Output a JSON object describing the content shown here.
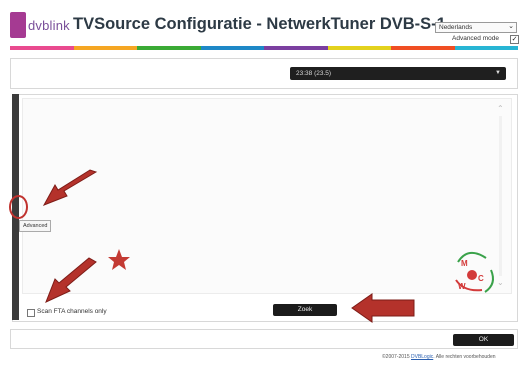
{
  "header": {
    "logo_text": "dvblink",
    "title": "TVSource Configuratie - NetwerkTuner DVB-S-1",
    "language": "Nederlands",
    "advanced_mode_label": "Advanced mode",
    "advanced_mode_checked": true,
    "advanced_check_glyph": "✓"
  },
  "stripe_colors": [
    "#e94a8f",
    "#f5a623",
    "#3aaa35",
    "#1e88c7",
    "#7b3fa0",
    "#e3d21d",
    "#f04e23",
    "#27b5d4"
  ],
  "top_panel": {
    "time_select": "23:38 (23.5)"
  },
  "main_panel": {
    "tooltip": "Advanced",
    "scan_fta_label": "Scan FTA channels only",
    "scan_fta_checked": false,
    "search_button": "Zoek"
  },
  "footer_bar": {
    "ok_button": "OK"
  },
  "copyright": {
    "prefix": "©2007-2015",
    "link": "DVBLogic",
    "suffix": ". Alle rechten voorbehouden"
  },
  "watermark_letters": [
    "M",
    "C",
    "W"
  ],
  "annotation_colors": {
    "arrow": "#b4322b",
    "star": "#c33a33"
  }
}
